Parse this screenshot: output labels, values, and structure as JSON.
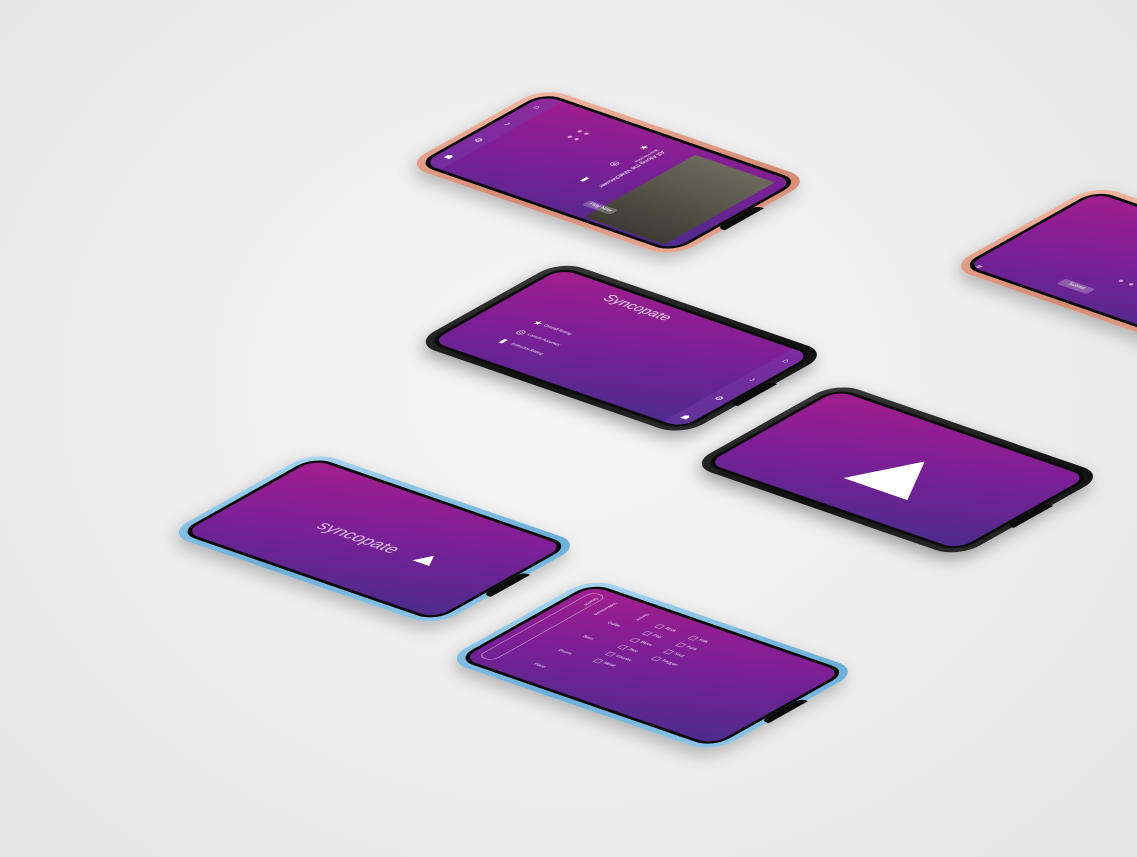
{
  "brand": {
    "name": "syncopate",
    "title": "Syncopate"
  },
  "video_screen": {
    "song_title": "All Along the Watchtower",
    "artist": "Jimi Hendrix",
    "play_button": "Play Now"
  },
  "ratings_screen": {
    "items": [
      {
        "label": "Overall Rating",
        "icon": "star-icon"
      },
      {
        "label": "Lesson Accuracy",
        "icon": "target-icon"
      },
      {
        "label": "Instructor Rating",
        "icon": "guitar-icon"
      }
    ]
  },
  "rating_form": {
    "submit_label": "Submit"
  },
  "filter_screen": {
    "search_placeholder": "Search",
    "section_instruments": "Instruments",
    "section_genre": "Genre",
    "instruments": [
      "Guitar",
      "Bass",
      "Drums",
      "Piano",
      "Vocals"
    ],
    "genres": [
      "Rock",
      "Pop",
      "Blues",
      "Jazz",
      "Country",
      "Metal",
      "Folk",
      "Funk",
      "Soul",
      "Reggae",
      "R&B",
      "Classical"
    ]
  },
  "colors": {
    "screen_top": "#a21e8e",
    "screen_bottom": "#4b2c8c",
    "accent": "#c93aa7"
  }
}
